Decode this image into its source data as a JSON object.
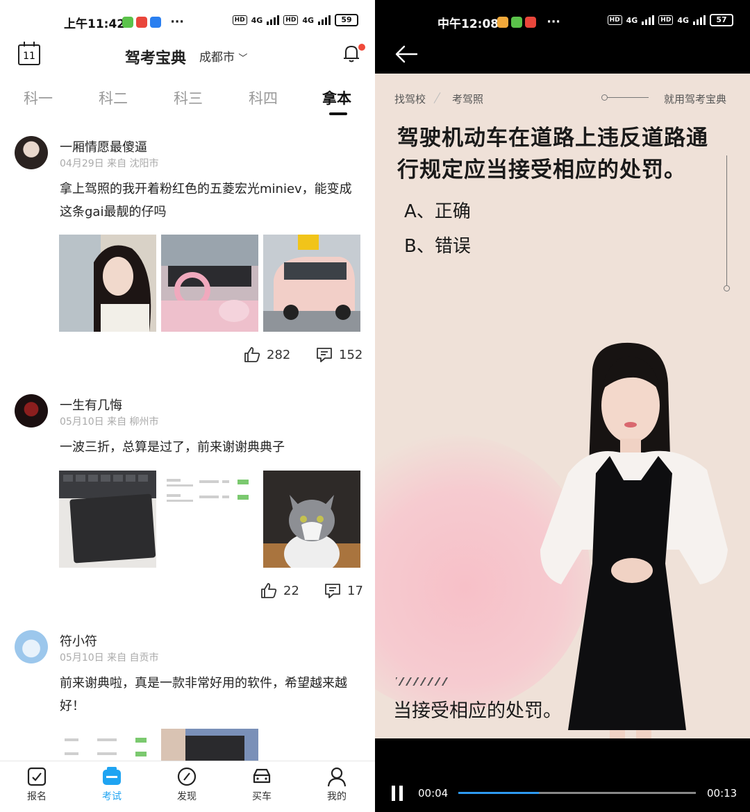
{
  "left": {
    "status": {
      "time": "上午11:42",
      "net1": "4G",
      "net2": "4G",
      "hd": "HD",
      "battery": "59"
    },
    "header": {
      "calendar_day": "11",
      "title": "驾考宝典",
      "city": "成都市"
    },
    "tabs": [
      "科一",
      "科二",
      "科三",
      "科四",
      "拿本"
    ],
    "active_tab": 4,
    "posts": [
      {
        "user": "一厢情愿最傻逼",
        "meta": "04月29日 来自 沈阳市",
        "text": "拿上驾照的我开着粉红色的五菱宏光miniev，能变成这条gai最靓的仔吗",
        "likes": "282",
        "comments": "152"
      },
      {
        "user": "一生有几悔",
        "meta": "05月10日 来自 柳州市",
        "text": "一波三折，总算是过了，前来谢谢典典子",
        "likes": "22",
        "comments": "17"
      },
      {
        "user": "符小符",
        "meta": "05月10日 来自 自贡市",
        "text": "前来谢典啦，真是一款非常好用的软件，希望越来越好！"
      }
    ],
    "nav": [
      {
        "label": "报名",
        "icon": "signup-icon"
      },
      {
        "label": "考试",
        "icon": "exam-icon"
      },
      {
        "label": "发现",
        "icon": "discover-icon"
      },
      {
        "label": "买车",
        "icon": "car-icon"
      },
      {
        "label": "我的",
        "icon": "profile-icon"
      }
    ],
    "nav_active": 1,
    "accent_color": "#1fa4f2"
  },
  "right": {
    "status": {
      "time": "中午12:08",
      "net1": "4G",
      "net2": "4G",
      "hd": "HD",
      "battery": "57"
    },
    "video": {
      "crumb1": "找驾校",
      "crumb2": "考驾照",
      "slogan": "就用驾考宝典",
      "question": "驾驶机动车在道路上违反道路通行规定应当接受相应的处罚。",
      "option_a": "A、正确",
      "option_b": "B、错误",
      "subtitle": "当接受相应的处罚。"
    },
    "player": {
      "current": "00:04",
      "total": "00:13",
      "progress": 0.34
    }
  }
}
